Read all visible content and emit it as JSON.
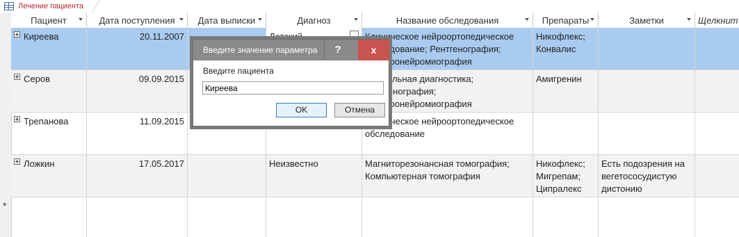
{
  "tab": {
    "label": "Лечение пациента"
  },
  "columns": [
    {
      "label": "Пациент",
      "has_arrow": true
    },
    {
      "label": "Дата поступления",
      "has_arrow": true
    },
    {
      "label": "Дата выписки",
      "has_arrow": true
    },
    {
      "label": "Диагноз",
      "has_arrow": true
    },
    {
      "label": "Название обследования",
      "has_arrow": true
    },
    {
      "label": "Препараты",
      "has_arrow": true
    },
    {
      "label": "Заметки",
      "has_arrow": true
    },
    {
      "label": "Щелкнит",
      "has_arrow": false
    }
  ],
  "rows": [
    {
      "patient": "Киреева",
      "admission": "20.11.2007",
      "discharge": "",
      "diagnosis": "Детский",
      "exam": "Клиническое нейроортопедическое обследование; Рентгенография; Электронейромиография",
      "drugs": "Никофлекс; Конвалис",
      "notes": ""
    },
    {
      "patient": "Серов",
      "admission": "09.09.2015",
      "discharge": "",
      "diagnosis": "",
      "exam": "Мануальная диагностика; Рентгенография; Электронейромиография",
      "drugs": "Амигренин",
      "notes": ""
    },
    {
      "patient": "Трепанова",
      "admission": "11.09.2015",
      "discharge": "",
      "diagnosis": "",
      "exam": "Клиническое нейроортопедическое обследование",
      "drugs": "",
      "notes": ""
    },
    {
      "patient": "Ложкин",
      "admission": "17.05.2017",
      "discharge": "",
      "diagnosis": "Неизвестно",
      "exam": "Магниторезонансная томография; Компьютерная томография",
      "drugs": "Никофлекс; Мигрепам; Ципралекс",
      "notes": "Есть подозрения на вегетососудистую дистонию"
    }
  ],
  "new_row_marker": "*",
  "dialog": {
    "title": "Введите значение параметра",
    "help_label": "?",
    "close_label": "x",
    "prompt": "Введите пациента",
    "input_value": "Киреева",
    "ok_label": "OK",
    "cancel_label": "Отмена"
  }
}
